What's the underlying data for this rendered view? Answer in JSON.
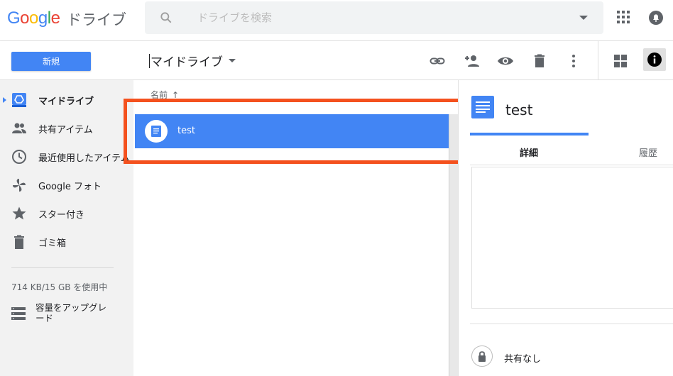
{
  "header": {
    "logo_parts": [
      "G",
      "o",
      "o",
      "g",
      "l",
      "e"
    ],
    "product": "ドライブ",
    "search_placeholder": "ドライブを検索"
  },
  "toolbar": {
    "new_label": "新規",
    "breadcrumb": "マイドライブ"
  },
  "sidebar": {
    "items": [
      {
        "label": "マイドライブ",
        "icon": "drive-icon",
        "active": true
      },
      {
        "label": "共有アイテム",
        "icon": "people-icon"
      },
      {
        "label": "最近使用したアイテム",
        "icon": "clock-icon"
      },
      {
        "label": "Google フォト",
        "icon": "pinwheel-icon"
      },
      {
        "label": "スター付き",
        "icon": "star-icon"
      },
      {
        "label": "ゴミ箱",
        "icon": "trash-icon"
      }
    ],
    "storage": "714 KB/15 GB を使用中",
    "upgrade": "容量をアップグレード"
  },
  "filelist": {
    "column_header": "名前",
    "sort_arrow": "↑",
    "files": [
      {
        "name": "test",
        "type": "document",
        "selected": true
      }
    ]
  },
  "details": {
    "title": "test",
    "tabs": [
      "詳細",
      "履歴"
    ],
    "sharing": "共有なし"
  },
  "colors": {
    "accent": "#4285f4",
    "highlight_box": "#f4511e",
    "sidebar_bg": "#f2f2f2"
  }
}
